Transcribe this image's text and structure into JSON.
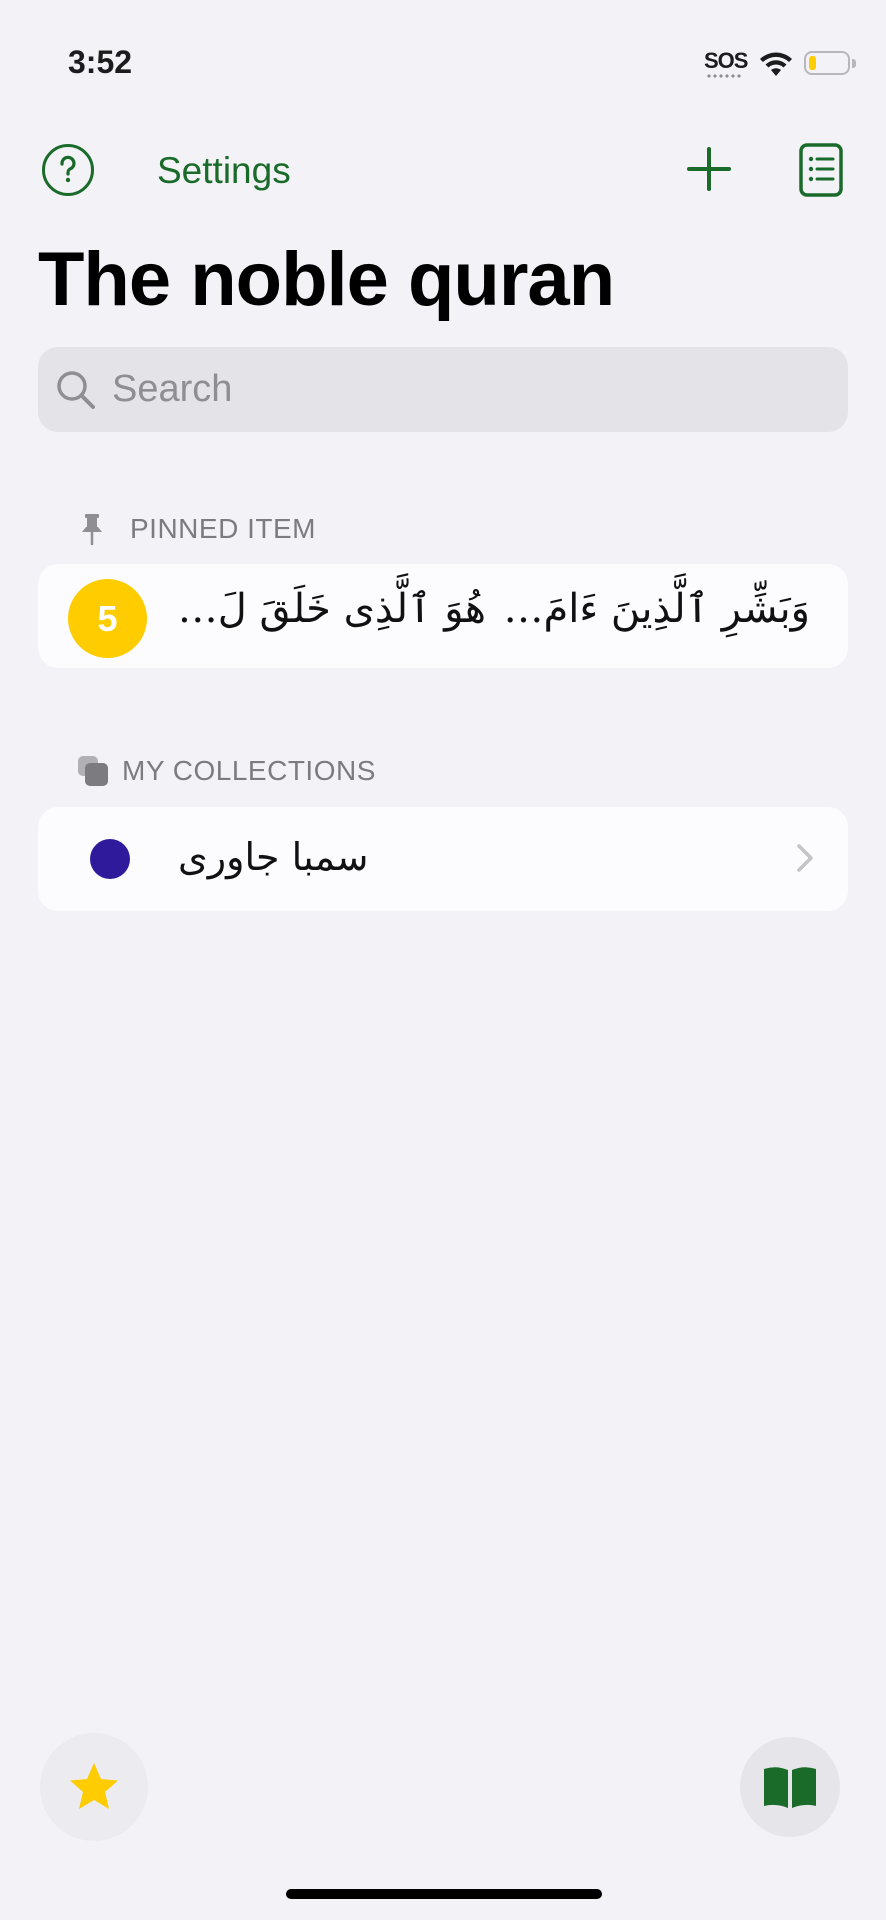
{
  "status_bar": {
    "time": "3:52",
    "sos": "SOS",
    "battery_level": 0.2,
    "icons": [
      "wifi-icon",
      "battery-icon"
    ]
  },
  "nav": {
    "help_icon": "help-circle-icon",
    "settings_label": "Settings",
    "add_icon": "plus-icon",
    "list_icon": "list-document-icon"
  },
  "page": {
    "title": "The noble quran"
  },
  "search": {
    "placeholder": "Search",
    "value": ""
  },
  "pinned": {
    "header": "PINNED ITEM",
    "header_icon": "pin-icon",
    "item": {
      "badge": "5",
      "verses": [
        "وَبَشِّرِ ٱلَّذِينَ ءَامَ…",
        "هُوَ ٱلَّذِى خَلَقَ لَ…"
      ]
    }
  },
  "collections": {
    "header": "MY COLLECTIONS",
    "header_icon": "collections-icon",
    "items": [
      {
        "name": "سمبا جاوری",
        "color": "#2e1a9a"
      }
    ]
  },
  "fab": {
    "favorites_icon": "star-icon",
    "read_icon": "open-book-icon"
  },
  "colors": {
    "accent": "#1a6b2a",
    "background": "#f2f2f7",
    "badge": "#ffcc00",
    "star": "#ffcc00"
  }
}
